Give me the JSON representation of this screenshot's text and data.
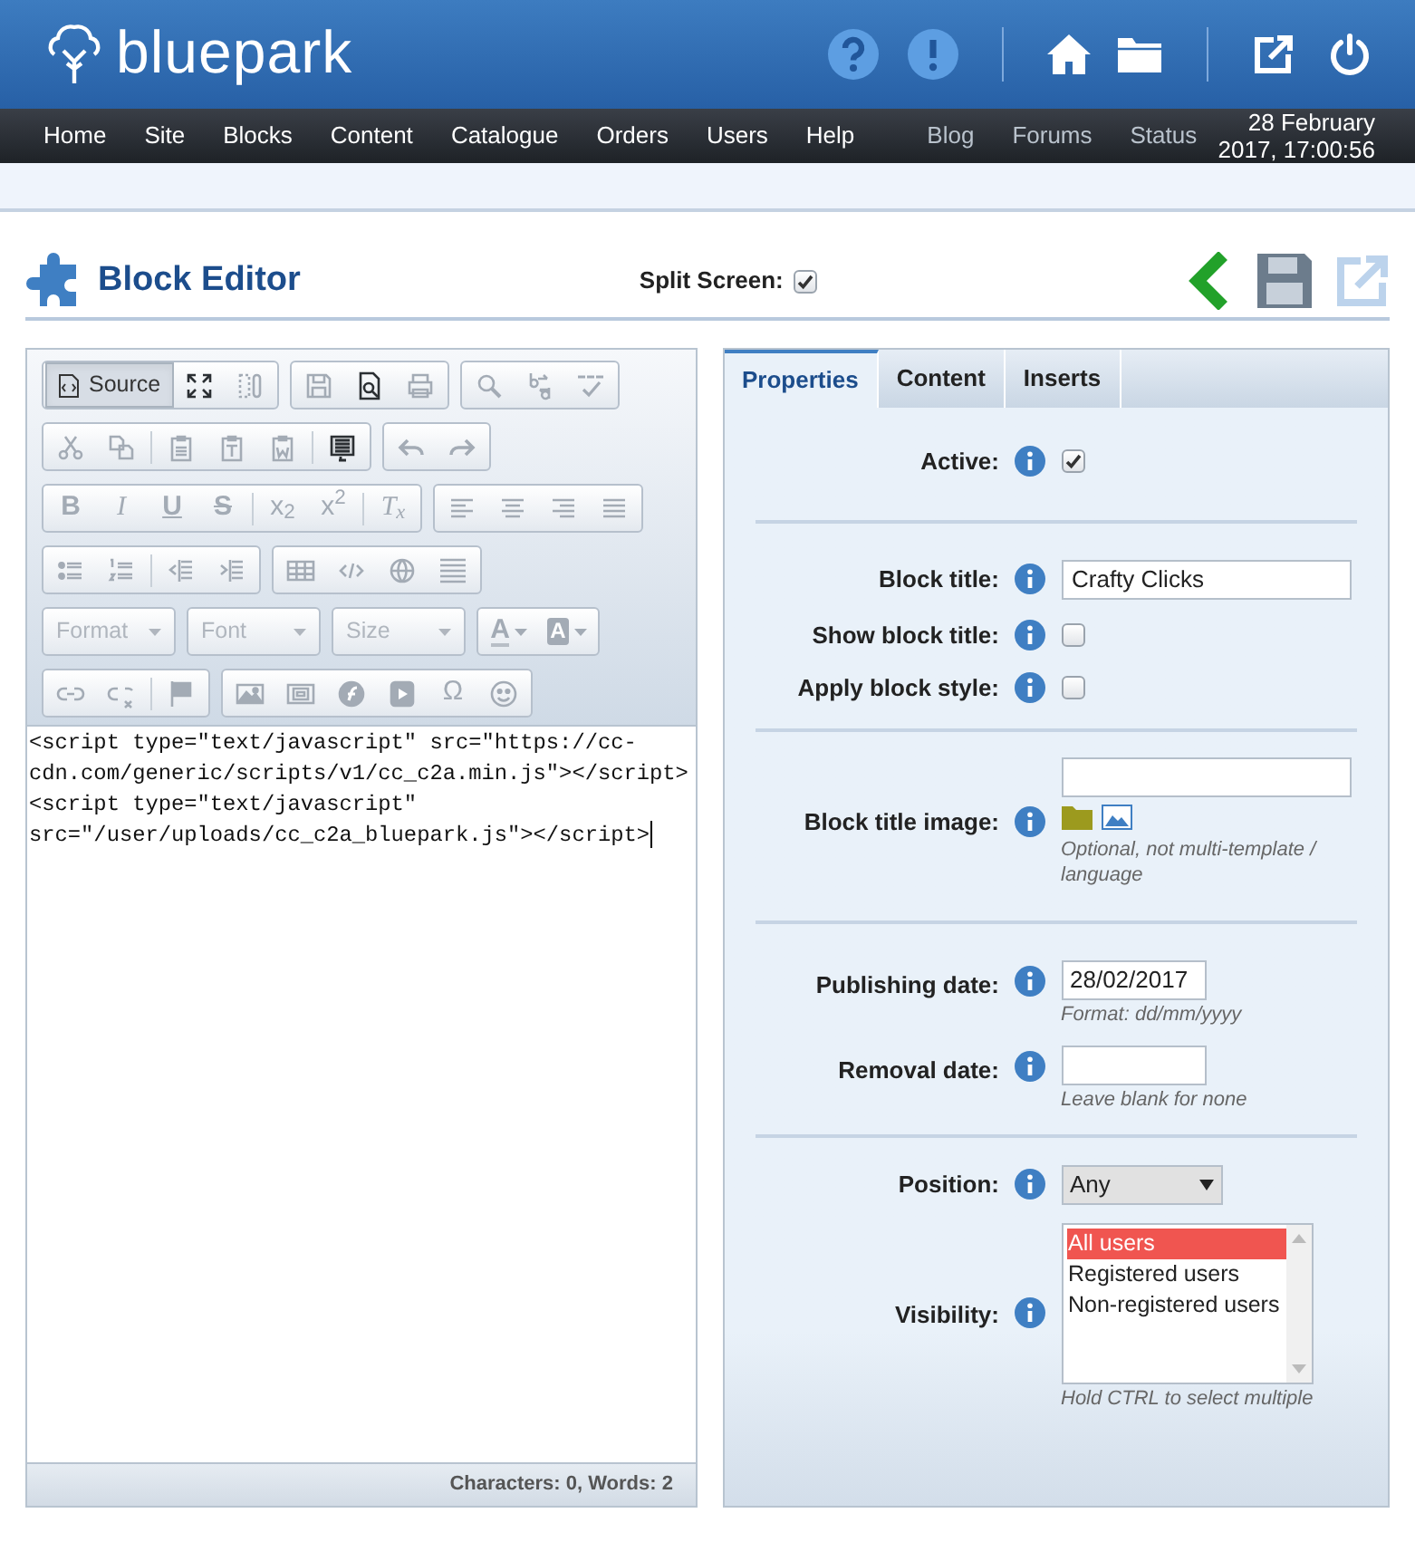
{
  "header": {
    "logo": "bluepark"
  },
  "nav": {
    "items": [
      "Home",
      "Site",
      "Blocks",
      "Content",
      "Catalogue",
      "Orders",
      "Users",
      "Help"
    ],
    "secondary": [
      "Blog",
      "Forums",
      "Status"
    ],
    "datetime": [
      "28 February",
      "2017, 17:00:56"
    ]
  },
  "page": {
    "title": "Block Editor",
    "split_screen": {
      "label": "Split Screen:",
      "checked": true
    }
  },
  "editor": {
    "toolbar": [
      [
        [
          {
            "kind": "source",
            "label": "Source",
            "selected": true
          },
          {
            "kind": "icon",
            "disabled": false
          },
          {
            "kind": "icon",
            "disabled": true
          }
        ],
        [
          {
            "kind": "icon",
            "disabled": true
          },
          {
            "kind": "icon",
            "disabled": false
          },
          {
            "kind": "icon",
            "disabled": true
          }
        ],
        [
          {
            "kind": "icon",
            "disabled": true
          },
          {
            "kind": "icon",
            "disabled": true
          },
          {
            "kind": "icon",
            "disabled": true
          }
        ]
      ],
      [
        [
          {
            "kind": "icon",
            "disabled": true
          },
          {
            "kind": "icon",
            "disabled": true
          },
          {
            "kind": "sep"
          },
          {
            "kind": "icon",
            "disabled": true
          },
          {
            "kind": "icon",
            "disabled": true
          },
          {
            "kind": "icon",
            "disabled": true
          },
          {
            "kind": "sep"
          },
          {
            "kind": "icon",
            "disabled": false
          }
        ],
        [
          {
            "kind": "icon",
            "disabled": true
          },
          {
            "kind": "icon",
            "disabled": true
          }
        ]
      ],
      [
        [
          {
            "kind": "bold",
            "text": "B"
          },
          {
            "kind": "italic",
            "text": "I"
          },
          {
            "kind": "underline",
            "text": "U"
          },
          {
            "kind": "strike",
            "text": "S"
          },
          {
            "kind": "sep"
          },
          {
            "kind": "glyph",
            "text": "x$_{2}$"
          },
          {
            "kind": "glyph",
            "text": "x$^{2}$"
          },
          {
            "kind": "sep"
          },
          {
            "kind": "italic",
            "text": "T$_{x}$"
          }
        ],
        [
          {
            "kind": "icon",
            "disabled": true
          },
          {
            "kind": "icon",
            "disabled": true
          },
          {
            "kind": "icon",
            "disabled": true
          },
          {
            "kind": "icon",
            "disabled": true
          }
        ]
      ],
      [
        [
          {
            "kind": "icon",
            "disabled": true
          },
          {
            "kind": "icon",
            "disabled": true
          },
          {
            "kind": "sep"
          },
          {
            "kind": "icon",
            "disabled": true
          },
          {
            "kind": "icon",
            "disabled": true
          }
        ],
        [
          {
            "kind": "icon",
            "disabled": true
          },
          {
            "kind": "icon",
            "disabled": true
          },
          {
            "kind": "icon",
            "disabled": true
          },
          {
            "kind": "icon",
            "disabled": true
          }
        ]
      ],
      [
        [
          {
            "kind": "combo",
            "label": "Format"
          }
        ],
        [
          {
            "kind": "combo",
            "label": "Font"
          }
        ],
        [
          {
            "kind": "combo",
            "label": "Size"
          }
        ],
        [
          {
            "kind": "color",
            "text": "A"
          },
          {
            "kind": "bgcolor",
            "text": "A"
          }
        ]
      ],
      [
        [
          {
            "kind": "icon",
            "disabled": true
          },
          {
            "kind": "icon",
            "disabled": true
          },
          {
            "kind": "sep"
          },
          {
            "kind": "icon",
            "disabled": true
          }
        ],
        [
          {
            "kind": "icon",
            "disabled": true
          },
          {
            "kind": "icon",
            "disabled": true
          },
          {
            "kind": "icon",
            "disabled": true
          },
          {
            "kind": "icon",
            "disabled": true
          },
          {
            "kind": "glyph",
            "text": "Ω"
          },
          {
            "kind": "icon",
            "disabled": true
          }
        ]
      ]
    ],
    "code_lines": [
      "<script type=\"text/javascript\" src=\"https://cc-",
      "cdn.com/generic/scripts/v1/cc_c2a.min.js\"></script>",
      "<script type=\"text/javascript\"",
      "src=\"/user/uploads/cc_c2a_bluepark.js\"></script>"
    ],
    "status": "Characters: 0, Words: 2"
  },
  "properties": {
    "tabs": [
      {
        "label": "Properties",
        "selected": true
      },
      {
        "label": "Content",
        "selected": false
      },
      {
        "label": "Inserts",
        "selected": false
      }
    ],
    "sections": [
      [
        {
          "kind": "checkbox",
          "label": "Active:",
          "checked": true
        }
      ],
      [
        {
          "kind": "text",
          "label": "Block title:",
          "value": "Crafty Clicks"
        },
        {
          "kind": "checkbox",
          "label": "Show block title:",
          "checked": false
        },
        {
          "kind": "checkbox",
          "label": "Apply block style:",
          "checked": false
        }
      ],
      [
        {
          "kind": "image",
          "label": "Block title image:",
          "hint": "Optional, not multi-template / language"
        }
      ],
      [
        {
          "kind": "date",
          "label": "Publishing date:",
          "value": "28/02/2017",
          "hint": "Format: dd/mm/yyyy"
        },
        {
          "kind": "date",
          "label": "Removal date:",
          "hint": "Leave blank for none"
        }
      ],
      [
        {
          "kind": "select",
          "label": "Position:",
          "value": "Any"
        },
        {
          "kind": "listbox",
          "label": "Visibility:",
          "options": [
            {
              "label": "All users",
              "selected": true
            },
            {
              "label": "Registered users",
              "selected": false
            },
            {
              "label": "Non-registered users",
              "selected": false
            }
          ],
          "hint": "Hold CTRL to select multiple"
        }
      ]
    ]
  }
}
